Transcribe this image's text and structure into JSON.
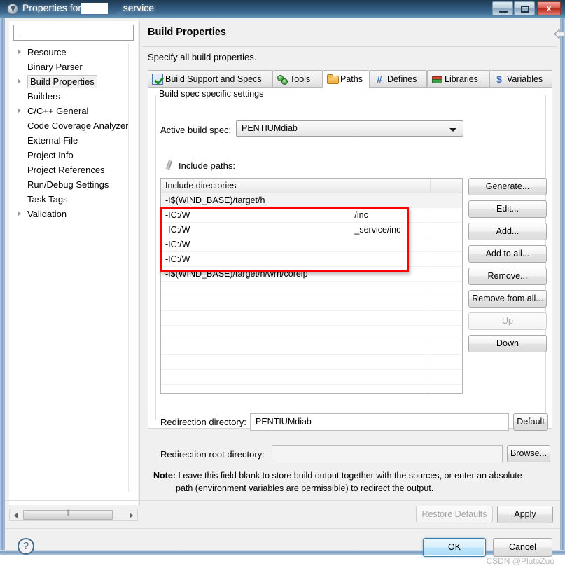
{
  "window": {
    "title": "Properties for",
    "title_redacted_suffix": "_service",
    "icon": "app-icon",
    "controls": {
      "minimize": "–",
      "maximize": "□",
      "close": "x"
    }
  },
  "sidebar": {
    "filter": {
      "value": "",
      "placeholder": ""
    },
    "items": [
      {
        "label": "Resource",
        "expandable": true
      },
      {
        "label": "Binary Parser",
        "expandable": false
      },
      {
        "label": "Build Properties",
        "expandable": true,
        "selected": true
      },
      {
        "label": "Builders",
        "expandable": false
      },
      {
        "label": "C/C++ General",
        "expandable": true
      },
      {
        "label": "Code Coverage Analyzer",
        "expandable": false
      },
      {
        "label": "External File",
        "expandable": false
      },
      {
        "label": "Project Info",
        "expandable": false
      },
      {
        "label": "Project References",
        "expandable": false
      },
      {
        "label": "Run/Debug Settings",
        "expandable": false
      },
      {
        "label": "Task Tags",
        "expandable": false
      },
      {
        "label": "Validation",
        "expandable": true
      }
    ]
  },
  "page": {
    "title": "Build Properties",
    "description": "Specify all build properties."
  },
  "nav": {
    "back": "back-arrow-icon",
    "forward": "forward-arrow-icon",
    "menu": "view-menu-icon"
  },
  "tabs": [
    {
      "label": "Build Support and Specs",
      "icon": "specs-icon",
      "active": false
    },
    {
      "label": "Tools",
      "icon": "tools-icon",
      "active": false
    },
    {
      "label": "Paths",
      "icon": "folder-icon",
      "active": true
    },
    {
      "label": "Defines",
      "icon": "hash-icon",
      "active": false
    },
    {
      "label": "Libraries",
      "icon": "books-icon",
      "active": false
    },
    {
      "label": "Variables",
      "icon": "dollar-icon",
      "active": false
    }
  ],
  "group": {
    "legend": "Build spec specific settings",
    "active_build_spec_label": "Active build spec:",
    "active_build_spec_value": "PENTIUMdiab",
    "include_paths_label": "Include paths:",
    "include_paths_icon": "pencil-icon"
  },
  "list": {
    "columns": [
      "Include directories",
      ""
    ],
    "rows": [
      {
        "text": "-I$(WIND_BASE)/target/h",
        "first": true,
        "highlighted": false
      },
      {
        "text": "-IC:/W",
        "suffix": "/inc",
        "first": false,
        "highlighted": true
      },
      {
        "text": "-IC:/W",
        "suffix": "_service/inc",
        "first": false,
        "highlighted": true
      },
      {
        "text": "-IC:/W",
        "suffix": "",
        "first": false,
        "highlighted": true
      },
      {
        "text": "-IC:/W",
        "suffix": "",
        "first": false,
        "highlighted": true
      },
      {
        "text": "-I$(WIND_BASE)/target/h/wrn/coreip",
        "first": false,
        "highlighted": false
      }
    ],
    "highlight_color": "#ff0000"
  },
  "side_buttons": [
    {
      "label": "Generate...",
      "enabled": true
    },
    {
      "label": "Edit...",
      "enabled": true
    },
    {
      "label": "Add...",
      "enabled": true
    },
    {
      "label": "Add to all...",
      "enabled": true
    },
    {
      "label": "Remove...",
      "enabled": true
    },
    {
      "label": "Remove from all...",
      "enabled": true
    },
    {
      "label": "Up",
      "enabled": false
    },
    {
      "label": "Down",
      "enabled": true
    }
  ],
  "redirection": {
    "dir_label": "Redirection directory:",
    "dir_value": "PENTIUMdiab",
    "default_button": "Default",
    "root_label": "Redirection root directory:",
    "root_value": "",
    "browse_button": "Browse..."
  },
  "note": {
    "prefix": "Note:",
    "line1": "Leave this field blank to store build output together with the sources, or enter an absolute",
    "line2": "path (environment variables are permissible) to redirect the output."
  },
  "footer": {
    "restore_defaults": "Restore Defaults",
    "apply": "Apply",
    "ok": "OK",
    "cancel": "Cancel",
    "help_icon": "help-question-icon",
    "watermark": "CSDN @PlutoZuo"
  },
  "scrollbar": {
    "left_arrow": "scroll-left-icon",
    "right_arrow": "scroll-right-icon"
  }
}
